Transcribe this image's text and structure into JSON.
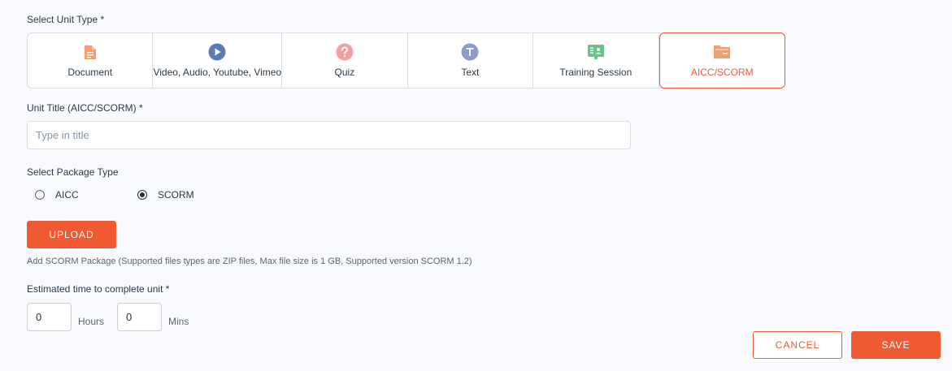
{
  "unit_type": {
    "heading": "Select Unit Type *",
    "options": [
      {
        "label": "Document",
        "icon": "document-icon",
        "color": "#f0a070"
      },
      {
        "label": "Video, Audio, Youtube, Vimeo",
        "icon": "play-icon",
        "color": "#5b7ab5"
      },
      {
        "label": "Quiz",
        "icon": "question-icon",
        "color": "#f0a0a0"
      },
      {
        "label": "Text",
        "icon": "text-icon",
        "color": "#8a9cc8"
      },
      {
        "label": "Training Session",
        "icon": "presentation-icon",
        "color": "#6dc08a"
      },
      {
        "label": "AICC/SCORM",
        "icon": "folder-icon",
        "color": "#f0a070"
      }
    ],
    "selected": "AICC/SCORM"
  },
  "unit_title": {
    "label": "Unit Title (AICC/SCORM) *",
    "placeholder": "Type in title",
    "value": ""
  },
  "package_type": {
    "label": "Select Package Type",
    "options": [
      {
        "label": "AICC",
        "checked": false
      },
      {
        "label": "SCORM",
        "checked": true
      }
    ]
  },
  "upload": {
    "button_label": "UPLOAD",
    "hint": "Add SCORM Package (Supported files types are ZIP files, Max file size is 1 GB, Supported version SCORM 1.2)"
  },
  "estimated_time": {
    "label": "Estimated time to complete unit *",
    "hours_value": "0",
    "hours_label": "Hours",
    "mins_value": "0",
    "mins_label": "Mins"
  },
  "actions": {
    "cancel_label": "CANCEL",
    "save_label": "SAVE"
  },
  "colors": {
    "accent": "#ef5a33",
    "border": "#d9dee5",
    "background": "#f7f9fc"
  }
}
